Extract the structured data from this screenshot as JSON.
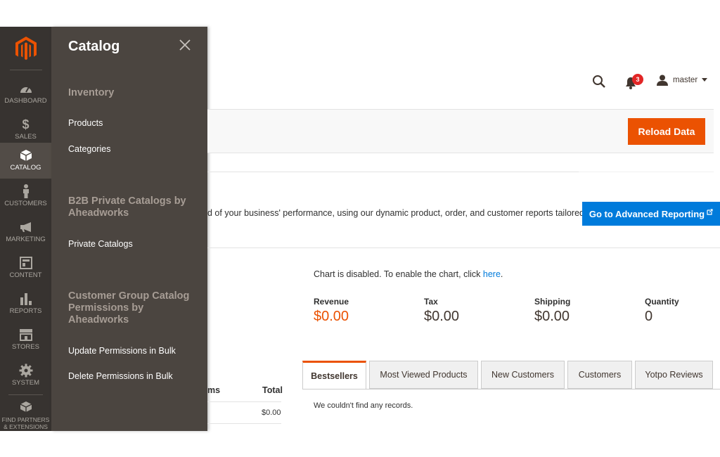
{
  "nav": {
    "items": [
      {
        "label": "DASHBOARD",
        "icon": "dashboard-icon"
      },
      {
        "label": "SALES",
        "icon": "dollar-icon"
      },
      {
        "label": "CATALOG",
        "icon": "box-icon"
      },
      {
        "label": "CUSTOMERS",
        "icon": "person-icon"
      },
      {
        "label": "MARKETING",
        "icon": "megaphone-icon"
      },
      {
        "label": "CONTENT",
        "icon": "layout-icon"
      },
      {
        "label": "REPORTS",
        "icon": "bar-chart-icon"
      },
      {
        "label": "STORES",
        "icon": "store-icon"
      },
      {
        "label": "SYSTEM",
        "icon": "gear-icon"
      },
      {
        "label": "FIND PARTNERS & EXTENSIONS",
        "icon": "boxes-icon"
      }
    ]
  },
  "flyout": {
    "title": "Catalog",
    "groups": [
      {
        "title": "Inventory",
        "links": [
          "Products",
          "Categories"
        ]
      },
      {
        "title": "B2B Private Catalogs by Aheadworks",
        "links": [
          "Private Catalogs"
        ]
      },
      {
        "title": "Customer Group Catalog Permissions by Aheadworks",
        "links": [
          "Update Permissions in Bulk",
          "Delete Permissions in Bulk"
        ]
      }
    ]
  },
  "header": {
    "notification_count": "3",
    "user_name": "master"
  },
  "reload_button": "Reload Data",
  "advanced_reporting": {
    "text": "d of your business' performance, using our dynamic product, order, and customer reports tailored",
    "button": "Go to Advanced Reporting"
  },
  "chart": {
    "message_prefix": "Chart is disabled. To enable the chart, click ",
    "link": "here",
    "message_suffix": "."
  },
  "kpis": [
    {
      "label": "Revenue",
      "value": "$0.00"
    },
    {
      "label": "Tax",
      "value": "$0.00"
    },
    {
      "label": "Shipping",
      "value": "$0.00"
    },
    {
      "label": "Quantity",
      "value": "0"
    }
  ],
  "left_table": {
    "col_items_fragment": "ms",
    "col_total": "Total",
    "row_total": "$0.00"
  },
  "tabs": [
    "Bestsellers",
    "Most Viewed Products",
    "New Customers",
    "Customers",
    "Yotpo Reviews"
  ],
  "empty_message": "We couldn't find any records.",
  "colors": {
    "accent_orange": "#eb5202",
    "link_blue": "#007bdb",
    "nav_bg": "#373330",
    "flyout_bg": "#4b4540"
  }
}
